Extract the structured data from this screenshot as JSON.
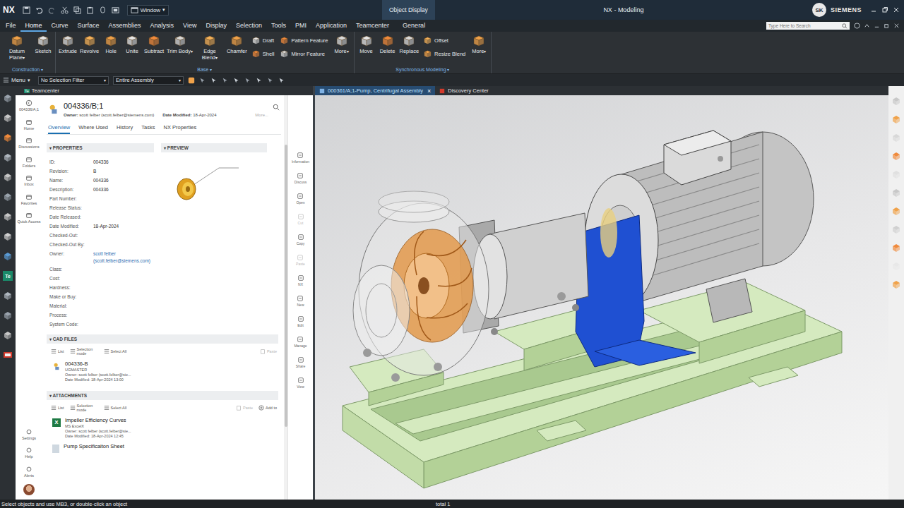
{
  "caret": "▾",
  "title_bar": {
    "logo": "NX",
    "window_menu": "Window",
    "context_tab": "Object Display",
    "title": "NX - Modeling",
    "user_initials": "SK",
    "brand": "SIEMENS"
  },
  "menu": [
    {
      "label": "File",
      "selected": false
    },
    {
      "label": "Home",
      "selected": true
    },
    {
      "label": "Curve",
      "selected": false
    },
    {
      "label": "Surface",
      "selected": false
    },
    {
      "label": "Assemblies",
      "selected": false
    },
    {
      "label": "Analysis",
      "selected": false
    },
    {
      "label": "View",
      "selected": false
    },
    {
      "label": "Display",
      "selected": false
    },
    {
      "label": "Selection",
      "selected": false
    },
    {
      "label": "Tools",
      "selected": false
    },
    {
      "label": "PMI",
      "selected": false
    },
    {
      "label": "Application",
      "selected": false
    },
    {
      "label": "Teamcenter",
      "selected": false
    },
    {
      "label": "General",
      "selected": false
    }
  ],
  "search": {
    "placeholder": "Type Here to Search"
  },
  "ribbon": [
    {
      "label": "Construction",
      "tools": [
        {
          "label": "Datum Plane",
          "kind": "large",
          "dropdown": true
        },
        {
          "label": "Sketch",
          "kind": "large",
          "dropdown": false
        }
      ]
    },
    {
      "label": "Base",
      "tools": [
        {
          "label": "Extrude",
          "kind": "large",
          "dropdown": false
        },
        {
          "label": "Revolve",
          "kind": "large",
          "dropdown": false
        },
        {
          "label": "Hole",
          "kind": "large",
          "dropdown": false
        },
        {
          "label": "Unite",
          "kind": "large",
          "dropdown": false
        },
        {
          "label": "Subtract",
          "kind": "large",
          "dropdown": false
        },
        {
          "label": "Trim Body",
          "kind": "large",
          "dropdown": true
        },
        {
          "label": "Edge Blend",
          "kind": "large",
          "dropdown": true
        },
        {
          "label": "Chamfer",
          "kind": "large",
          "dropdown": false
        },
        {
          "label": "Draft",
          "kind": "small",
          "dropdown": false
        },
        {
          "label": "Shell",
          "kind": "small",
          "dropdown": false
        },
        {
          "label": "Pattern Feature",
          "kind": "small",
          "dropdown": false
        },
        {
          "label": "Mirror Feature",
          "kind": "small",
          "dropdown": false
        },
        {
          "label": "More",
          "kind": "large",
          "dropdown": true
        }
      ]
    },
    {
      "label": "Synchronous Modeling",
      "tools": [
        {
          "label": "Move",
          "kind": "large",
          "dropdown": false
        },
        {
          "label": "Delete",
          "kind": "large",
          "dropdown": false
        },
        {
          "label": "Replace",
          "kind": "large",
          "dropdown": false
        },
        {
          "label": "Offset",
          "kind": "small",
          "dropdown": false
        },
        {
          "label": "Resize Blend",
          "kind": "small",
          "dropdown": false
        },
        {
          "label": "More",
          "kind": "large",
          "dropdown": true
        }
      ]
    }
  ],
  "selection_bar": {
    "menu": "Menu",
    "filter": "No Selection Filter",
    "scope": "Entire Assembly"
  },
  "left_toolbar": {
    "teamcenter_badge": "Te"
  },
  "teamcenter": {
    "title": "Teamcenter",
    "nav": [
      {
        "label": "004336/A;1"
      },
      {
        "label": "Home"
      },
      {
        "label": "Discussions"
      },
      {
        "label": "Folders"
      },
      {
        "label": "Inbox"
      },
      {
        "label": "Favorites"
      },
      {
        "label": "Quick Access"
      }
    ],
    "nav_bottom": [
      {
        "label": "Settings"
      },
      {
        "label": "Help"
      },
      {
        "label": "Alerts"
      }
    ],
    "header": {
      "id": "004336/B;1",
      "owner_label": "Owner:",
      "owner": "scott felber (scott.felber@siemens.com)",
      "date_label": "Date Modified:",
      "date": "18-Apr-2024",
      "more": "More..."
    },
    "tabs": [
      {
        "label": "Overview",
        "selected": true
      },
      {
        "label": "Where Used",
        "selected": false
      },
      {
        "label": "History",
        "selected": false
      },
      {
        "label": "Tasks",
        "selected": false
      },
      {
        "label": "NX Properties",
        "selected": false
      }
    ],
    "properties": {
      "title": "PROPERTIES",
      "fields": [
        {
          "label": "ID:",
          "value": "004336",
          "link": false
        },
        {
          "label": "Revision:",
          "value": "B",
          "link": false
        },
        {
          "label": "Name:",
          "value": "004336",
          "link": false
        },
        {
          "label": "Description:",
          "value": "004336",
          "link": false
        },
        {
          "label": "Part Number:",
          "value": "",
          "link": false
        },
        {
          "label": "Release Status:",
          "value": "",
          "link": false
        },
        {
          "label": "Date Released:",
          "value": "",
          "link": false
        },
        {
          "label": "Date Modified:",
          "value": "18-Apr-2024",
          "link": false
        },
        {
          "label": "Checked-Out:",
          "value": "",
          "link": false
        },
        {
          "label": "Checked-Out By:",
          "value": "",
          "link": false
        },
        {
          "label": "Owner:",
          "value": "scott felber (scott.felber@siemens.com)",
          "link": true
        },
        {
          "label": "Class:",
          "value": "",
          "link": false
        },
        {
          "label": "Cost:",
          "value": "",
          "link": false
        },
        {
          "label": "Hardness:",
          "value": "",
          "link": false
        },
        {
          "label": "Make or Buy:",
          "value": "",
          "link": false
        },
        {
          "label": "Material:",
          "value": "",
          "link": false
        },
        {
          "label": "Process:",
          "value": "",
          "link": false
        },
        {
          "label": "System Code:",
          "value": "",
          "link": false
        }
      ]
    },
    "preview": {
      "title": "PREVIEW"
    },
    "cad_files": {
      "title": "CAD FILES",
      "toolbar": [
        "List",
        "Selection mode",
        "Select All"
      ],
      "paste": "Paste",
      "items": [
        {
          "name": "004336-B",
          "type": "UGMASTER",
          "owner": "Owner: scott felber (scott.felber@sie...",
          "date": "Date Modified: 18-Apr-2024 13:00"
        }
      ]
    },
    "attachments": {
      "title": "ATTACHMENTS",
      "toolbar": [
        "List",
        "Selection mode",
        "Select All"
      ],
      "paste": "Paste",
      "add": "Add to",
      "items": [
        {
          "name": "Impeller Efficiency Curves",
          "type": "MS ExcelX",
          "owner": "Owner: scott felber (scott.felber@sie...",
          "date": "Date Modified: 18-Apr-2024 12:45",
          "icon_letter": "X"
        },
        {
          "name": "Pump Specificaiton Sheet"
        }
      ]
    },
    "actions": [
      {
        "label": "Information",
        "disabled": false
      },
      {
        "label": "Discuss",
        "disabled": false
      },
      {
        "label": "Open",
        "disabled": false
      },
      {
        "label": "Cut",
        "disabled": true
      },
      {
        "label": "Copy",
        "disabled": false
      },
      {
        "label": "Paste",
        "disabled": true
      },
      {
        "label": "NX",
        "disabled": false
      },
      {
        "label": "New",
        "disabled": false
      },
      {
        "label": "Edit",
        "disabled": false
      },
      {
        "label": "Manage",
        "disabled": false
      },
      {
        "label": "Share",
        "disabled": false
      },
      {
        "label": "View",
        "disabled": false
      }
    ]
  },
  "graphics": {
    "close": "×",
    "tabs": [
      {
        "label": "000361/A;1-Pump, Centrifugal Assembly",
        "selected": true
      },
      {
        "label": "Discovery Center",
        "selected": false
      }
    ]
  },
  "status_bar": {
    "prompt": "Select objects and use MB3, or double-click an object",
    "count": "total 1"
  }
}
